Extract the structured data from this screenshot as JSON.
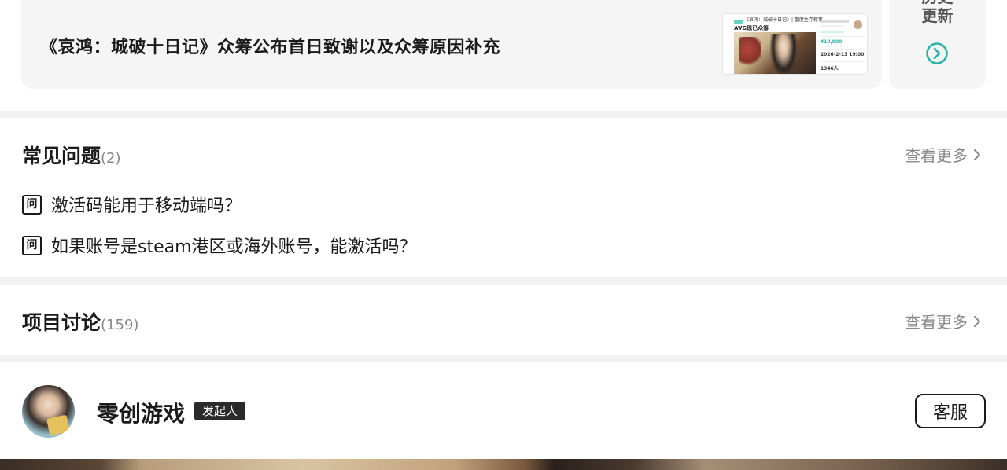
{
  "update": {
    "title": "《哀鸿：城破十日记》众筹公布首日致谢以及众筹原因补充",
    "thumb": {
      "caption": "《哀鸿：城破十日记》| 重度生存叙事",
      "caption2": "AVG现已众筹",
      "amount": "¥10,000",
      "date": "2026-2-13 19:00",
      "people": "1346人"
    }
  },
  "history": {
    "line1": "历史",
    "line2": "更新",
    "icon": "chevron-circle-right-icon",
    "accent_color": "#2bb3a6"
  },
  "faq": {
    "title": "常见问题",
    "count": "(2)",
    "see_more": "查看更多",
    "q_icon_glyph": "问",
    "items": [
      {
        "text": "激活码能用于移动端吗？"
      },
      {
        "text": "如果账号是steam港区或海外账号，能激活吗？"
      }
    ]
  },
  "discussion": {
    "title": "项目讨论",
    "count": "(159)",
    "see_more": "查看更多"
  },
  "initiator": {
    "name": "零创游戏",
    "badge": "发起人",
    "service_button": "客服"
  }
}
